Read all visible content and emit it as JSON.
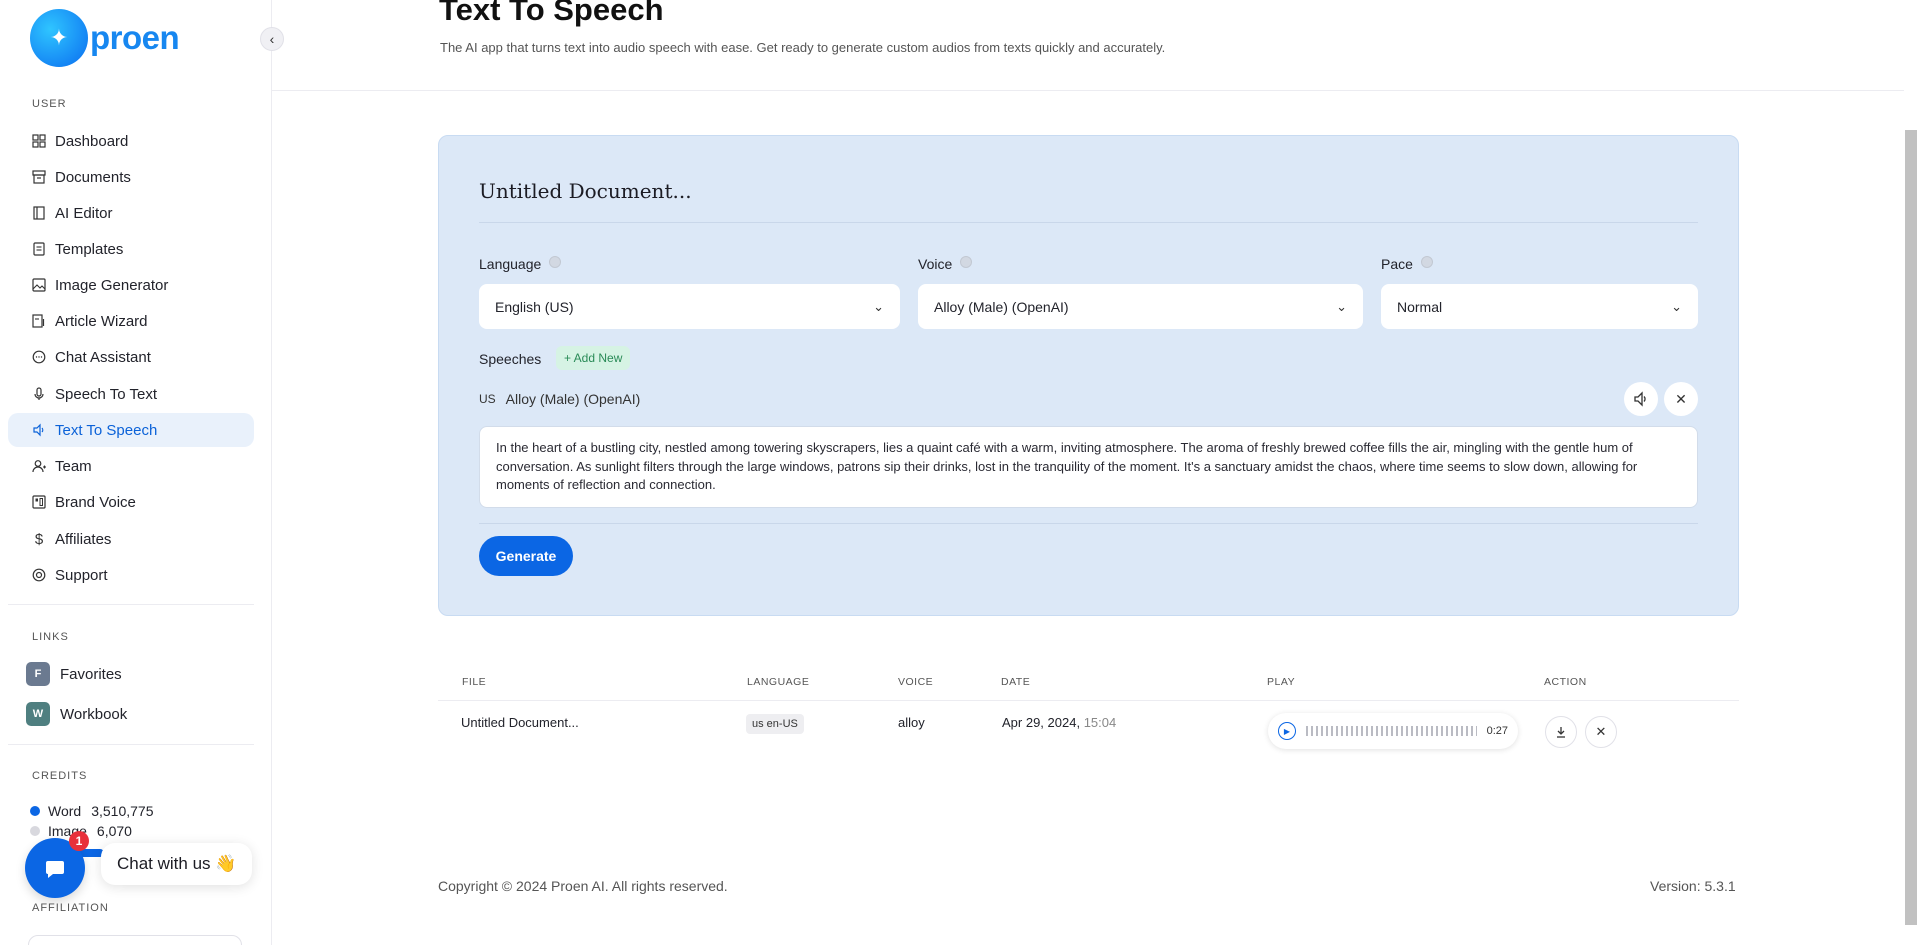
{
  "brand": {
    "name": "proen"
  },
  "sidebar": {
    "user_section": "USER",
    "items": [
      {
        "label": "Dashboard",
        "icon": "dashboard-icon"
      },
      {
        "label": "Documents",
        "icon": "archive-icon"
      },
      {
        "label": "AI Editor",
        "icon": "book-icon"
      },
      {
        "label": "Templates",
        "icon": "file-text-icon"
      },
      {
        "label": "Image Generator",
        "icon": "image-icon"
      },
      {
        "label": "Article Wizard",
        "icon": "file-edit-icon"
      },
      {
        "label": "Chat Assistant",
        "icon": "message-circle-icon"
      },
      {
        "label": "Speech To Text",
        "icon": "microphone-icon"
      },
      {
        "label": "Text To Speech",
        "icon": "speaker-icon"
      },
      {
        "label": "Team",
        "icon": "user-plus-icon"
      },
      {
        "label": "Brand Voice",
        "icon": "layout-icon"
      },
      {
        "label": "Affiliates",
        "icon": "dollar-icon"
      },
      {
        "label": "Support",
        "icon": "lifebuoy-icon"
      }
    ],
    "active_item": "Text To Speech",
    "links_section": "LINKS",
    "links": [
      {
        "badge": "F",
        "label": "Favorites",
        "color": "#6b7a90"
      },
      {
        "badge": "W",
        "label": "Workbook",
        "color": "#4f7f80"
      }
    ],
    "credits_section": "CREDITS",
    "credits": [
      {
        "label": "Word",
        "value": "3,510,775",
        "color": "#0b66e4"
      },
      {
        "label": "Image",
        "value": "6,070",
        "color": "#d8d8de"
      }
    ],
    "affiliation_section": "AFFILIATION"
  },
  "chat": {
    "badge_count": "1",
    "bubble": "Chat with us 👋"
  },
  "header": {
    "title": "Text To Speech",
    "subtitle": "The AI app that turns text into audio speech with ease. Get ready to generate custom audios from texts quickly and accurately."
  },
  "form": {
    "document_title": "Untitled Document...",
    "language_label": "Language",
    "language_value": "English (US)",
    "voice_label": "Voice",
    "voice_value": "Alloy (Male) (OpenAI)",
    "pace_label": "Pace",
    "pace_value": "Normal",
    "speeches_label": "Speeches",
    "add_new_label": "+ Add New",
    "speech_flag": "US",
    "speech_voice": "Alloy (Male) (OpenAI)",
    "speech_text": "In the heart of a bustling city, nestled among towering skyscrapers, lies a quaint café with a warm, inviting atmosphere. The aroma of freshly brewed coffee fills the air, mingling with the gentle hum of conversation. As sunlight filters through the large windows, patrons sip their drinks, lost in the tranquility of the moment. It's a sanctuary amidst the chaos, where time seems to slow down, allowing for moments of reflection and connection.",
    "generate_label": "Generate"
  },
  "table": {
    "headers": {
      "file": "FILE",
      "language": "LANGUAGE",
      "voice": "VOICE",
      "date": "DATE",
      "play": "PLAY",
      "action": "ACTION"
    },
    "rows": [
      {
        "file": "Untitled Document...",
        "language": "us en-US",
        "voice": "alloy",
        "date": "Apr 29, 2024,",
        "time": "15:04",
        "duration": "0:27"
      }
    ]
  },
  "footer": {
    "copyright": "Copyright © 2024 Proen AI. All rights reserved.",
    "version": "Version: 5.3.1"
  }
}
